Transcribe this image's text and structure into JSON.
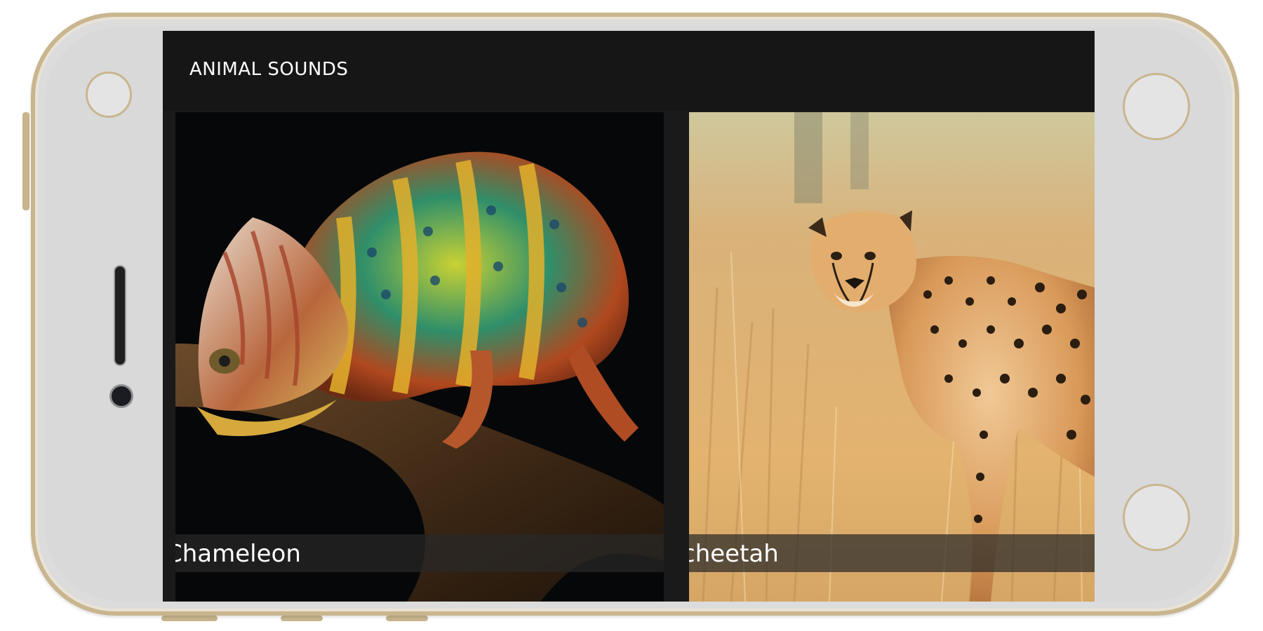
{
  "app": {
    "title": "ANIMAL SOUNDS"
  },
  "tiles": [
    {
      "label": "Chameleon",
      "image": "chameleon-photo"
    },
    {
      "label": "cheetah",
      "image": "cheetah-photo"
    }
  ],
  "colors": {
    "frame_gold": "#c9b58e",
    "phone_body": "#dcdcdc",
    "app_bar": "#161616",
    "label_bar": "#282828"
  }
}
